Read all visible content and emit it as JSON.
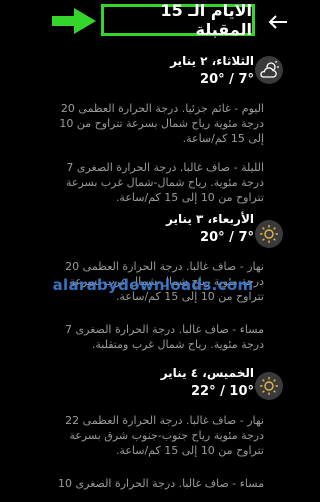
{
  "header": {
    "title": "الايام الـ 15 المقبلة",
    "back_icon": "back-arrow-icon",
    "annotation_color": "#35d62c"
  },
  "days": [
    {
      "title": "الثلاثاء، ٢ يناير",
      "temps": "7° / 20°",
      "icon": "partly-cloudy-icon",
      "day_text": "اليوم - غائم جزئيا. درجة الحرارة العظمى 20 درجة مئوية رياح شمال بسرعة تتراوح من 10 إلى 15 كم/ساعة.",
      "night_text": "الليلة - صاف غالبا. درجة الحرارة الصغرى 7 درجة مئوية. رياح شمال-شمال غرب بسرعة تتراوح من 10 إلى 15 كم/ساعة."
    },
    {
      "title": "الأربعاء، ٣ يناير",
      "temps": "7° / 20°",
      "icon": "sun-icon",
      "day_text": "نهار - صاف غالبا. درجة الحرارة العظمى 20 درجة مئوية رياح شمال-شمال غرب بسرعة تتراوح من 10 إلى 15 كم/ساعة.",
      "night_text": "مساء - صاف غالبا. درجة الحرارة الصغرى 7 درجة مئوية. رياح شمال غرب ومتقلبة."
    },
    {
      "title": "الخميس، ٤ يناير",
      "temps": "10° / 22°",
      "icon": "sun-icon",
      "day_text": "نهار - صاف غالبا. درجة الحرارة العظمى 22 درجة مئوية رياح جنوب-جنوب شرق بسرعة تتراوح من 10 إلى 15 كم/ساعة.",
      "night_text": "مساء - صاف غالبا. درجة الحرارة الصغرى 10"
    }
  ],
  "watermark": "alarabydownloads.com"
}
